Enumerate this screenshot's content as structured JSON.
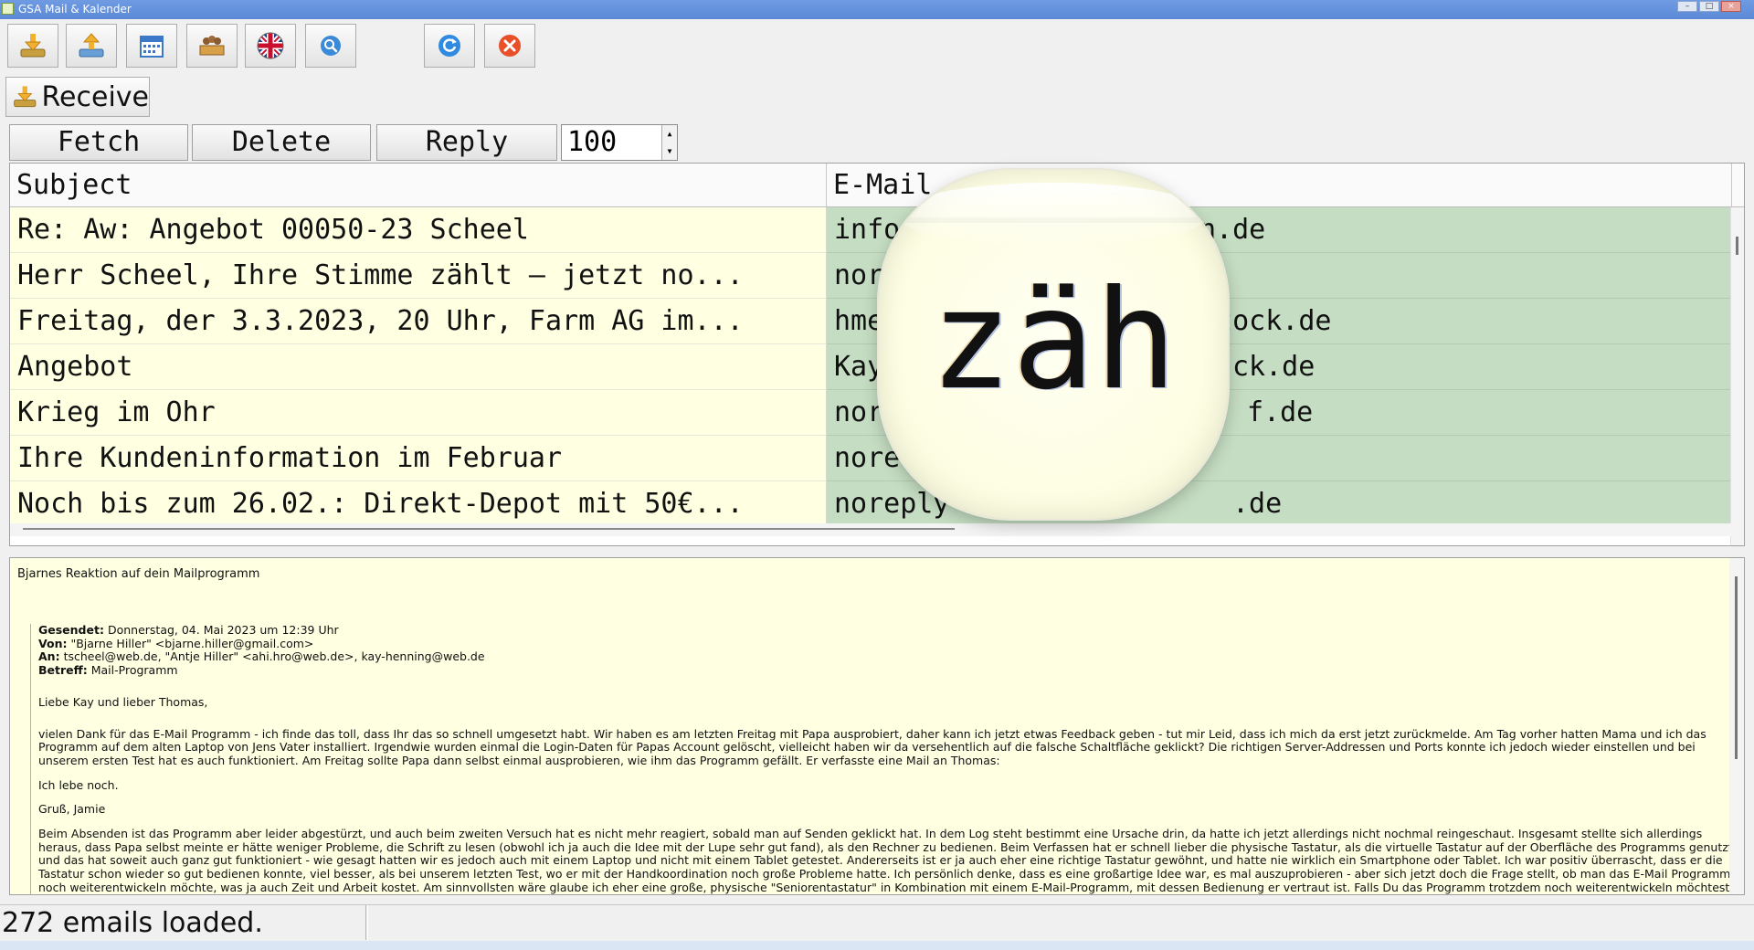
{
  "window": {
    "title": "GSA Mail & Kalender",
    "minimize": "–",
    "maximize": "□",
    "close": "×"
  },
  "toolbar": {
    "icons": [
      "download-icon",
      "upload-icon",
      "calendar-icon",
      "contacts-icon",
      "uk-flag-icon",
      "search-icon",
      "refresh-icon",
      "close-icon"
    ]
  },
  "receive_label": "Receive",
  "actions": {
    "fetch": "Fetch",
    "delete": "Delete",
    "reply": "Reply",
    "count": "100"
  },
  "columns": {
    "subject": "Subject",
    "email": "E-Mail",
    "extra": ""
  },
  "emails": [
    {
      "subject": "Re: Aw: Angebot 00050-23 Scheel",
      "email": "info",
      "email_tail": "n.de"
    },
    {
      "subject": "Herr Scheel, Ihre Stimme zählt – jetzt no...",
      "email": "nor",
      "email_tail": ""
    },
    {
      "subject": "Freitag, der 3.3.2023, 20 Uhr, Farm AG im...",
      "email": "hme",
      "email_tail": "stock.de"
    },
    {
      "subject": "Angebot",
      "email": "Kay",
      "email_tail": "ck.de"
    },
    {
      "subject": "Krieg im Ohr",
      "email": "nor",
      "email_tail": "f.de"
    },
    {
      "subject": "Ihre Kundeninformation im Februar",
      "email": "nore",
      "email_tail": ""
    },
    {
      "subject": "Noch bis zum 26.02.: Direkt-Depot mit 50€...",
      "email": "noreply",
      "email_tail": ".de"
    }
  ],
  "magnifier_text": "zäh",
  "preview": {
    "subject": "Bjarnes Reaktion auf dein Mailprogramm",
    "sent_label": "Gesendet:",
    "sent_value": "Donnerstag, 04. Mai 2023 um 12:39 Uhr",
    "from_label": "Von:",
    "from_value": "\"Bjarne Hiller\" <bjarne.hiller@gmail.com>",
    "to_label": "An:",
    "to_value": "tscheel@web.de, \"Antje Hiller\" <ahi.hro@web.de>, kay-henning@web.de",
    "subject_label": "Betreff:",
    "subject_value": "Mail-Programm",
    "greeting": "Liebe Kay und lieber Thomas,",
    "para1": "vielen Dank für das E-Mail Programm - ich finde das toll, dass Ihr das so schnell umgesetzt habt. Wir haben es am letzten Freitag mit Papa ausprobiert, daher kann ich jetzt etwas Feedback geben - tut mir Leid, dass ich mich da erst jetzt zurückmelde. Am Tag vorher hatten Mama und ich das Programm auf dem alten Laptop von Jens Vater installiert. Irgendwie wurden einmal die Login-Daten für Papas Account gelöscht, vielleicht haben wir da versehentlich auf die falsche Schaltfläche geklickt? Die richtigen Server-Addressen und Ports konnte ich jedoch wieder einstellen und bei unserem ersten Test hat es auch funktioniert. Am Freitag sollte Papa dann selbst einmal ausprobieren, wie ihm das Programm gefällt. Er verfasste eine Mail an Thomas:",
    "quote1": "Ich lebe noch.",
    "quote2": "Gruß, Jamie",
    "para2": "Beim Absenden ist das Programm aber leider abgestürzt, und auch beim zweiten Versuch hat es nicht mehr reagiert, sobald man auf Senden geklickt hat. In dem Log steht bestimmt eine Ursache drin, da hatte ich jetzt allerdings nicht nochmal reingeschaut. Insgesamt stellte sich allerdings heraus, dass Papa selbst meinte er hätte weniger Probleme, die Schrift zu lesen (obwohl ich ja auch die Idee mit der Lupe sehr gut fand), als den Rechner zu bedienen. Beim Verfassen hat er schnell lieber die physische Tastatur, als die virtuelle Tastatur auf der Oberfläche des Programms genutzt und das hat soweit auch ganz gut funktioniert - wie gesagt hatten wir es jedoch auch mit einem Laptop und nicht mit einem Tablet getestet. Andererseits ist er ja auch eher eine richtige Tastatur gewöhnt, und hatte nie wirklich ein Smartphone oder Tablet. Ich war positiv überrascht, dass er die Tastatur schon wieder so gut bedienen konnte, viel besser, als bei unserem letzten Test, wo er mit der Handkoordination noch große Probleme hatte. Ich persönlich denke, dass es eine großartige Idee war, es mal auszuprobieren - aber sich jetzt doch die Frage stellt, ob man das E-Mail Programm noch weiterentwickeln möchte, was ja auch Zeit und Arbeit kostet. Am sinnvollsten wäre glaube ich eher eine große, physische \"Seniorentastatur\" in Kombination mit einem E-Mail-Programm, mit dessen Bedienung er vertraut ist. Falls Du das Programm trotzdem noch weiterentwickeln möchtest, habe ich hier nochmal ein paar konkrete Anregungen:"
  },
  "status": "272 emails loaded."
}
